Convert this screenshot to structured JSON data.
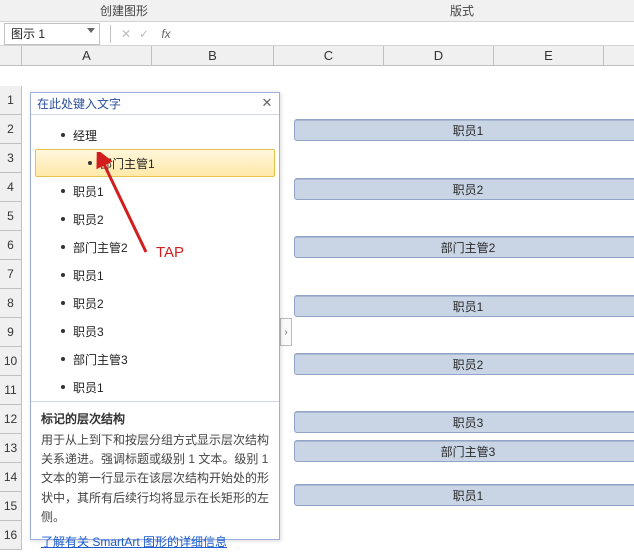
{
  "ribbon": {
    "group1": "创建图形",
    "group2": "版式"
  },
  "namebox": {
    "value": "图示 1"
  },
  "columns": [
    "A",
    "B",
    "C",
    "D",
    "E"
  ],
  "rows": [
    "1",
    "2",
    "3",
    "4",
    "5",
    "6",
    "7",
    "8",
    "9",
    "10",
    "11",
    "12",
    "13",
    "14",
    "15",
    "16"
  ],
  "pane": {
    "title": "在此处键入文字",
    "items": [
      {
        "label": "经理",
        "level": 1,
        "selected": false
      },
      {
        "label": "部门主管1",
        "level": 2,
        "selected": true
      },
      {
        "label": "职员1",
        "level": 1,
        "selected": false
      },
      {
        "label": "职员2",
        "level": 1,
        "selected": false
      },
      {
        "label": "部门主管2",
        "level": 1,
        "selected": false
      },
      {
        "label": "职员1",
        "level": 1,
        "selected": false
      },
      {
        "label": "职员2",
        "level": 1,
        "selected": false
      },
      {
        "label": "职员3",
        "level": 1,
        "selected": false
      },
      {
        "label": "部门主管3",
        "level": 1,
        "selected": false
      },
      {
        "label": "职员1",
        "level": 1,
        "selected": false
      }
    ],
    "info_title": "标记的层次结构",
    "info_body": "用于从上到下和按层分组方式显示层次结构关系递进。强调标题或级别 1 文本。级别 1 文本的第一行显示在该层次结构开始处的形状中，其所有后续行均将显示在长矩形的左侧。",
    "info_link": "了解有关 SmartArt 图形的详细信息"
  },
  "smartart_bars": [
    "职员1",
    "职员2",
    "部门主管2",
    "职员1",
    "职员2",
    "职员3",
    "部门主管3",
    "职员1"
  ],
  "annotation": {
    "tap": "TAP"
  }
}
